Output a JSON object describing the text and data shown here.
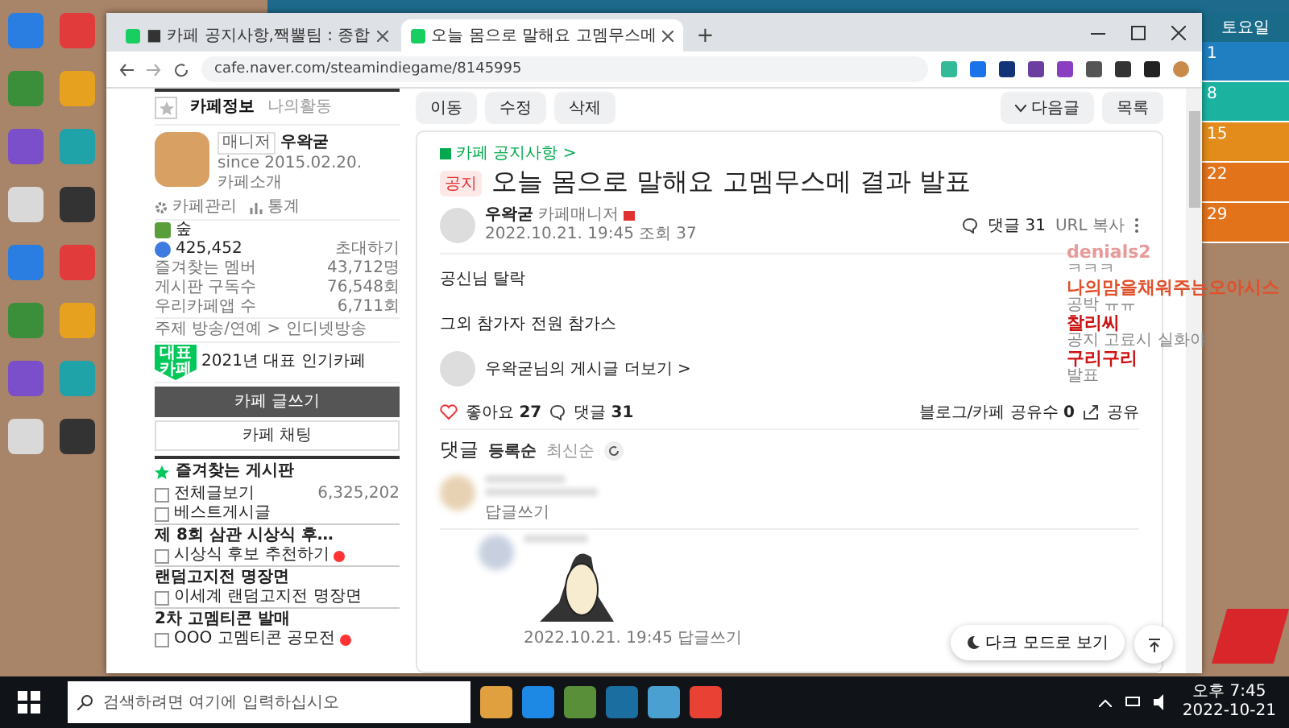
{
  "browser": {
    "tabs": [
      {
        "title": "■ 카페 공지사항,짹뿔팀 : 종합",
        "selected": false
      },
      {
        "title": "오늘 몸으로 말해요 고멤무스메",
        "selected": true
      }
    ],
    "new_tab": "+",
    "url": "cafe.naver.com/steamindiegame/8145995"
  },
  "sidebar": {
    "tabs": [
      {
        "label": "카페정보",
        "selected": true
      },
      {
        "label": "나의활동",
        "selected": false
      }
    ],
    "manager_badge": "매니저",
    "manager": "우왁굳",
    "since": "since 2015.02.20.",
    "intro": "카페소개",
    "admin": "카페관리",
    "stats": "통계",
    "level": "숲",
    "members": "425,452",
    "invite": "초대하기",
    "stats_rows": [
      {
        "label": "즐겨찾는 멤버",
        "value": "43,712명"
      },
      {
        "label": "게시판 구독수",
        "value": "76,548회"
      },
      {
        "label": "우리카페앱 수",
        "value": "6,711회"
      }
    ],
    "topic": "주제 방송/연예 > 인디넷방송",
    "award_badge": "대표카페",
    "award": "2021년 대표 인기카페",
    "write_button": "카페 글쓰기",
    "chat_button": "카페 채팅",
    "favorites": "즐겨찾는 게시판",
    "boards": [
      {
        "kind": "board",
        "label": "전체글보기",
        "count": "6,325,202",
        "new": false
      },
      {
        "kind": "board",
        "label": "베스트게시글",
        "new": false
      },
      {
        "kind": "header",
        "label": "제 8회 삼관 시상식 후…"
      },
      {
        "kind": "board",
        "label": "시상식 후보 추천하기",
        "new": true
      },
      {
        "kind": "header",
        "label": "랜덤고지전 명장면"
      },
      {
        "kind": "board",
        "label": "이세계 랜덤고지전 명장면",
        "new": false
      },
      {
        "kind": "header",
        "label": "2차 고멤티콘 발매"
      },
      {
        "kind": "board",
        "label": "OOO 고멤티콘 공모전",
        "new": true
      }
    ]
  },
  "toolbar": {
    "left": [
      "이동",
      "수정",
      "삭제"
    ],
    "next": "다음글",
    "list": "목록"
  },
  "post": {
    "category": "카페 공지사항 >",
    "tag": "공지",
    "title": "오늘 몸으로 말해요 고멤무스메 결과 발표",
    "author": "우왁굳",
    "role": "카페매니저",
    "date": "2022.10.21. 19:45",
    "views": "조회 37",
    "comments": "댓글 31",
    "url_copy": "URL 복사",
    "body": [
      "공신님 탈락",
      "그외 참가자 전원 참가스"
    ],
    "more": "우왁굳님의 게시글 더보기 >",
    "like_label": "좋아요",
    "like_count": "27",
    "liked": false,
    "comment_label": "댓글",
    "comment_count": "31",
    "share_count_label": "블로그/카페 공유수",
    "share_count": "0",
    "share": "공유"
  },
  "comments": {
    "title": "댓글",
    "sort": [
      {
        "label": "등록순",
        "selected": true
      },
      {
        "label": "최신순",
        "selected": false
      }
    ],
    "reply": "답글쓰기",
    "second_date": "2022.10.21. 19:45",
    "second_reply": "답글쓰기"
  },
  "dark_mode": "다크 모드로 보기",
  "chat": [
    {
      "name": "denials2",
      "text": "ㅋㅋㅋ",
      "color": "#e89a9a"
    },
    {
      "name": "나의맘을채워주는오아시스",
      "text": "공박 ㅠㅠ",
      "color": "#e0502a"
    },
    {
      "name": "찰리씨",
      "text": "공지 고료시 실화야",
      "color": "#cc1111"
    },
    {
      "name": "구리구리",
      "text": "발표",
      "color": "#cc1111"
    }
  ],
  "calendar": {
    "header": "토요일",
    "days": [
      "1",
      "8",
      "15",
      "22",
      "29"
    ]
  },
  "taskbar": {
    "search": "검색하려면 여기에 입력하십시오",
    "time": "오후 7:45",
    "date": "2022-10-21"
  }
}
